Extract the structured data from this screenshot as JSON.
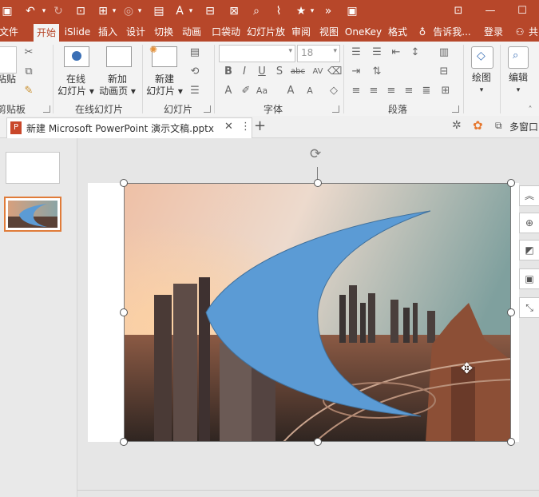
{
  "titlebar": {
    "min_label": "—",
    "restore_label": "☐"
  },
  "tabs": [
    {
      "label": "文件"
    },
    {
      "label": "开始"
    },
    {
      "label": "iSlide"
    },
    {
      "label": "插入"
    },
    {
      "label": "设计"
    },
    {
      "label": "切换"
    },
    {
      "label": "动画"
    },
    {
      "label": "口袋动"
    },
    {
      "label": "幻灯片放"
    },
    {
      "label": "审阅"
    },
    {
      "label": "视图"
    },
    {
      "label": "OneKey"
    },
    {
      "label": "格式"
    },
    {
      "label": "告诉我..."
    },
    {
      "label": "登录"
    },
    {
      "label": "共"
    }
  ],
  "ribbon": {
    "clipboard": {
      "paste_label": "粘贴",
      "group_label": "剪贴板"
    },
    "online_slides": {
      "btn1_line1": "在线",
      "btn1_line2": "幻灯片",
      "btn2_line1": "新加",
      "btn2_line2": "动画页",
      "group_label": "在线幻灯片"
    },
    "slides": {
      "new_line1": "新建",
      "new_line2": "幻灯片",
      "group_label": "幻灯片"
    },
    "font": {
      "font_name": "",
      "font_size": "18",
      "group_label": "字体"
    },
    "paragraph": {
      "group_label": "段落"
    },
    "drawing": {
      "label": "绘图"
    },
    "editing": {
      "label": "编辑"
    }
  },
  "docbar": {
    "doc_title": "新建 Microsoft PowerPoint 演示文稿.pptx",
    "multiwindow_label": "多窗口"
  },
  "thumbnails": [
    {
      "slide": 1,
      "selected": false
    },
    {
      "slide": 2,
      "selected": true
    }
  ],
  "colors": {
    "accent": "#b7472a",
    "shape_fill": "#5b9bd5",
    "selection": "#e07b39"
  }
}
